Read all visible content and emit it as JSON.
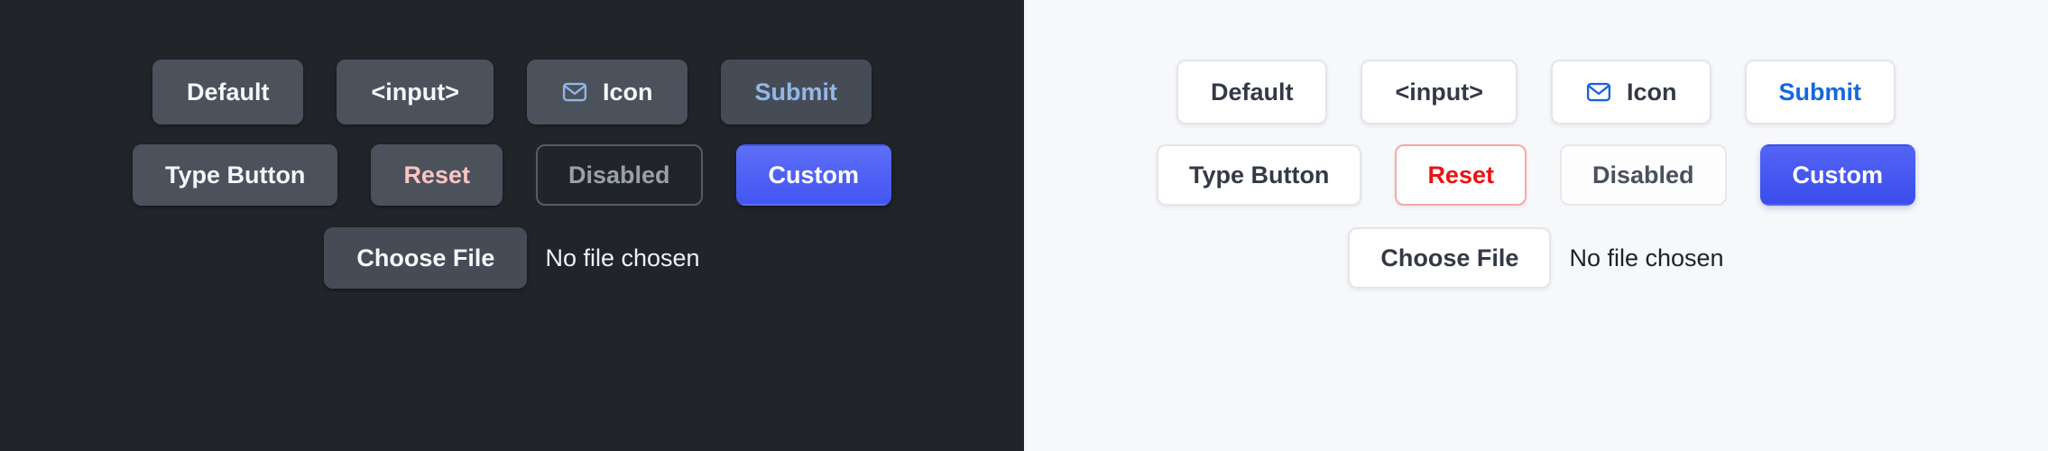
{
  "panels": [
    {
      "theme": "dark",
      "background_color": "#212429",
      "rows": [
        {
          "buttons": [
            {
              "label": "Default",
              "name": "default-button",
              "variant": "solid"
            },
            {
              "label": "<input>",
              "name": "input-button",
              "variant": "solid"
            },
            {
              "label": "Icon",
              "name": "icon-button",
              "variant": "solid",
              "icon": "mail-icon",
              "icon_color": "#8fb6e6"
            },
            {
              "label": "Submit",
              "name": "submit-button",
              "variant": "submit",
              "text_color": "#93b7e8"
            }
          ]
        },
        {
          "buttons": [
            {
              "label": "Type Button",
              "name": "type-button",
              "variant": "solid"
            },
            {
              "label": "Reset",
              "name": "reset-button",
              "variant": "reset",
              "text_color": "#fcc4c4"
            },
            {
              "label": "Disabled",
              "name": "disabled-button",
              "variant": "disabled",
              "text_color": "#9aa0a8"
            },
            {
              "label": "Custom",
              "name": "custom-button",
              "variant": "custom",
              "accent_color": "#4d5ef5"
            }
          ]
        }
      ],
      "file_input": {
        "button_label": "Choose File",
        "status_text": "No file chosen"
      }
    },
    {
      "theme": "light",
      "background_color": "#f7f8fa",
      "rows": [
        {
          "buttons": [
            {
              "label": "Default",
              "name": "default-button",
              "variant": "solid"
            },
            {
              "label": "<input>",
              "name": "input-button",
              "variant": "solid"
            },
            {
              "label": "Icon",
              "name": "icon-button",
              "variant": "solid",
              "icon": "mail-icon",
              "icon_color": "#1a62e0"
            },
            {
              "label": "Submit",
              "name": "submit-button",
              "variant": "submit",
              "text_color": "#1667e0"
            }
          ]
        },
        {
          "buttons": [
            {
              "label": "Type Button",
              "name": "type-button",
              "variant": "solid"
            },
            {
              "label": "Reset",
              "name": "reset-button",
              "variant": "reset",
              "text_color": "#ee1111",
              "border_color": "#f9a7a7"
            },
            {
              "label": "Disabled",
              "name": "disabled-button",
              "variant": "disabled",
              "text_color": "#4a515c"
            },
            {
              "label": "Custom",
              "name": "custom-button",
              "variant": "custom",
              "accent_color": "#4356f2"
            }
          ]
        }
      ],
      "file_input": {
        "button_label": "Choose File",
        "status_text": "No file chosen"
      }
    }
  ]
}
